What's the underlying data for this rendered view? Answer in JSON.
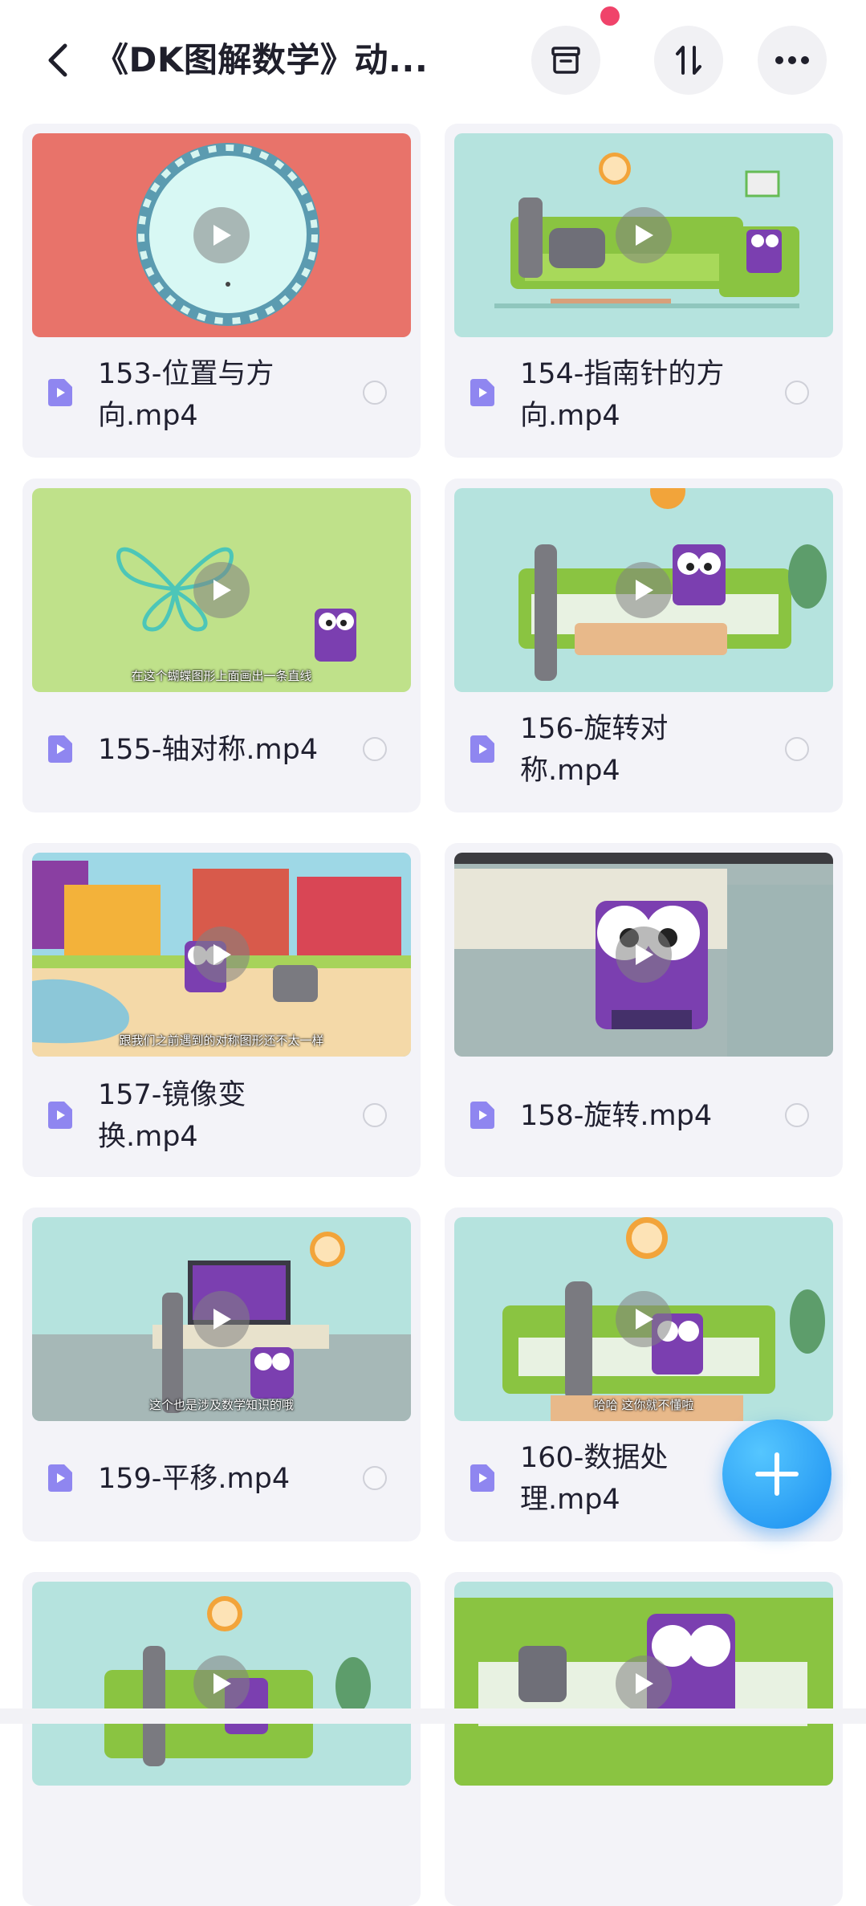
{
  "header": {
    "title": "《DK图解数学》动...",
    "back_icon": "chevron-left-icon",
    "actions": [
      {
        "name": "archive-icon"
      },
      {
        "name": "sort-icon"
      },
      {
        "name": "more-icon"
      }
    ]
  },
  "files": [
    {
      "name": "153-位置与方向.mp4",
      "line1": "153-位置与方",
      "line2": "向.mp4",
      "thumb_color": "#e8736a"
    },
    {
      "name": "154-指南针的方向.mp4",
      "line1": "154-指南针的方",
      "line2": "向.mp4",
      "thumb_color": "#b5e3de"
    },
    {
      "name": "155-轴对称.mp4",
      "line1": "155-轴对称.mp4",
      "line2": "",
      "thumb_color": "#bfe18a",
      "caption": "在这个蝴蝶图形上面画出一条直线"
    },
    {
      "name": "156-旋转对称.mp4",
      "line1": "156-旋转对",
      "line2": "称.mp4",
      "thumb_color": "#b5e3de"
    },
    {
      "name": "157-镜像变换.mp4",
      "line1": "157-镜像变",
      "line2": "换.mp4",
      "thumb_color": "#f4d9a8",
      "caption": "跟我们之前遇到的对称图形还不太一样"
    },
    {
      "name": "158-旋转.mp4",
      "line1": "158-旋转.mp4",
      "line2": "",
      "thumb_color": "#a6b8b7"
    },
    {
      "name": "159-平移.mp4",
      "line1": "159-平移.mp4",
      "line2": "",
      "thumb_color": "#b5e3de",
      "caption": "这个也是涉及数学知识的哦"
    },
    {
      "name": "160-数据处理.mp4",
      "line1": "160-数据处",
      "line2": "理.mp4",
      "thumb_color": "#b5e3de",
      "caption": "哈哈 这你就不懂啦"
    },
    {
      "name": "",
      "line1": "",
      "line2": "",
      "thumb_color": "#b5e3de"
    },
    {
      "name": "",
      "line1": "",
      "line2": "",
      "thumb_color": "#b5e3de"
    }
  ],
  "fab": {
    "icon": "plus-icon"
  },
  "colors": {
    "accent": "#1a8ef0",
    "file_icon": "#8f86f0",
    "notify_dot": "#f0436a",
    "card_bg": "#f3f3f8"
  }
}
